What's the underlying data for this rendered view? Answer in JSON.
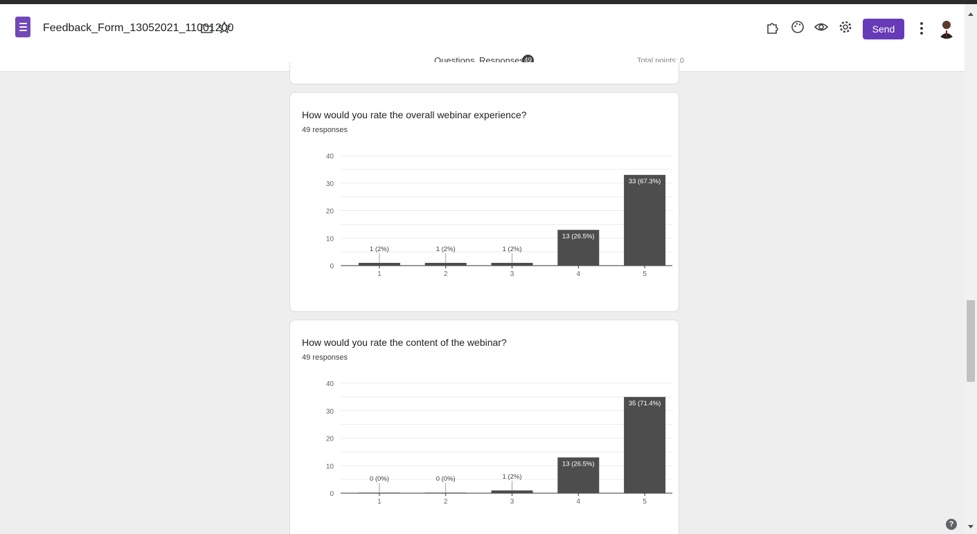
{
  "header": {
    "doc_title": "Feedback_Form_13052021_11001200",
    "send_label": "Send",
    "icons": [
      "addons-icon",
      "palette-icon",
      "preview-eye-icon",
      "settings-gear-icon",
      "more-vert-icon",
      "avatar"
    ],
    "accent_color": "#673ab7"
  },
  "tabs": {
    "questions": "Questions",
    "responses": "Responses",
    "responses_count": "49",
    "total_points": "Total points: 0"
  },
  "questions": [
    {
      "title": "How would you rate the overall webinar experience?",
      "response_count": "49 responses"
    },
    {
      "title": "How would you rate the content of the webinar?",
      "response_count": "49 responses"
    }
  ],
  "chart_data": [
    {
      "type": "bar",
      "categories": [
        "1",
        "2",
        "3",
        "4",
        "5"
      ],
      "values": [
        1,
        1,
        1,
        13,
        33
      ],
      "data_labels": [
        "1 (2%)",
        "1 (2%)",
        "1 (2%)",
        "13 (26.5%)",
        "33 (67.3%)"
      ],
      "yticks": [
        0,
        10,
        20,
        30,
        40
      ],
      "ylim": [
        0,
        40
      ],
      "grid": true,
      "bar_color": "#4d4d4d"
    },
    {
      "type": "bar",
      "categories": [
        "1",
        "2",
        "3",
        "4",
        "5"
      ],
      "values": [
        0,
        0,
        1,
        13,
        35
      ],
      "data_labels": [
        "0 (0%)",
        "0 (0%)",
        "1 (2%)",
        "13 (26.5%)",
        "35 (71.4%)"
      ],
      "yticks": [
        0,
        10,
        20,
        30,
        40
      ],
      "ylim": [
        0,
        40
      ],
      "grid": true,
      "bar_color": "#4d4d4d"
    }
  ]
}
